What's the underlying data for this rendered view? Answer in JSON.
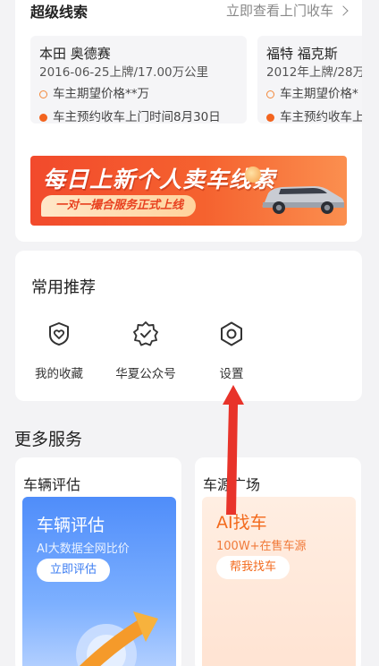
{
  "leads": {
    "title": "超级线索",
    "link": "立即查看上门收车",
    "cars": [
      {
        "name": "本田 奥德赛",
        "meta": "2016-06-25上牌/17.00万公里",
        "price_line": "车主期望价格**万",
        "visit_line": "车主预约收车上门时间8月30日"
      },
      {
        "name": "福特 福克斯",
        "meta": "2012年上牌/28万",
        "price_line": "车主期望价格*",
        "visit_line": "车主预约收车上"
      }
    ]
  },
  "banner": {
    "title": "每日上新个人卖车线索",
    "subtitle": "一对一撮合服务正式上线"
  },
  "recommend": {
    "title": "常用推荐",
    "items": [
      {
        "label": "我的收藏",
        "icon": "heart-shield-icon"
      },
      {
        "label": "华夏公众号",
        "icon": "badge-check-icon"
      },
      {
        "label": "设置",
        "icon": "settings-hexagon-icon"
      }
    ]
  },
  "more": {
    "title": "更多服务",
    "valuation": {
      "header": "车辆评估",
      "title": "车辆评估",
      "subtitle": "AI大数据全网比价",
      "button": "立即评估"
    },
    "source": {
      "header": "车源广场",
      "title": "AI找车",
      "subtitle": "100W+在售车源",
      "button": "帮我找车"
    }
  },
  "colors": {
    "accent_orange": "#f36a1d",
    "accent_blue": "#4f8dfa",
    "banner_red": "#f24a2c",
    "annotation_red": "#e8332a"
  }
}
